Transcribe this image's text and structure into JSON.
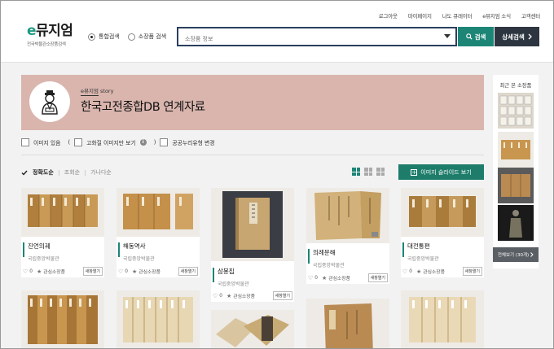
{
  "header": {
    "util_links": [
      "로그아웃",
      "마이페이지",
      "나도 큐레이터",
      "e뮤지엄 소식",
      "고객센터"
    ],
    "logo_e": "e",
    "logo_text": "뮤지엄",
    "logo_sub": "전국박물관소장품검색",
    "radio_options": [
      {
        "label": "통합검색",
        "selected": true
      },
      {
        "label": "소장품 검색",
        "selected": false
      }
    ],
    "search_placeholder": "소장품 정보",
    "search_button": "검색",
    "detail_button": "상세검색"
  },
  "banner": {
    "tag": "e뮤지엄 story",
    "title": "한국고전종합DB 연계자료"
  },
  "filters": {
    "image_only": "이미지 있음",
    "high_res": "고화질 이미지만 보기",
    "open_type": "공공누리유형 변경"
  },
  "sort": {
    "options": [
      "정확도순",
      "조회순",
      "가나다순"
    ],
    "active": "정확도순"
  },
  "slide_button": "이미지 슬라이드 보기",
  "cards": [
    {
      "title": "진언의궤",
      "museum": "국립중앙박물관",
      "likes": "0",
      "interest": "관심소장품",
      "new_window": "새창열기"
    },
    {
      "title": "해동역사",
      "museum": "국립중앙박물관",
      "likes": "0",
      "interest": "관심소장품",
      "new_window": "새창열기"
    },
    {
      "title": "삼봉집",
      "museum": "국립중앙박물관",
      "likes": "0",
      "interest": "관심소장품",
      "new_window": "새창열기"
    },
    {
      "title": "의례문해",
      "museum": "국립중앙박물관",
      "likes": "0",
      "interest": "관심소장품",
      "new_window": "새창열기"
    },
    {
      "title": "대전통편",
      "museum": "국립중앙박물관",
      "likes": "0",
      "interest": "관심소장품",
      "new_window": "새창열기"
    }
  ],
  "side": {
    "title": "최근 본 소장품",
    "more": "전체보기 (30개)"
  },
  "colors": {
    "accent": "#1c8576",
    "banner": "#d9b5ae",
    "dark_button": "#2d3640"
  }
}
